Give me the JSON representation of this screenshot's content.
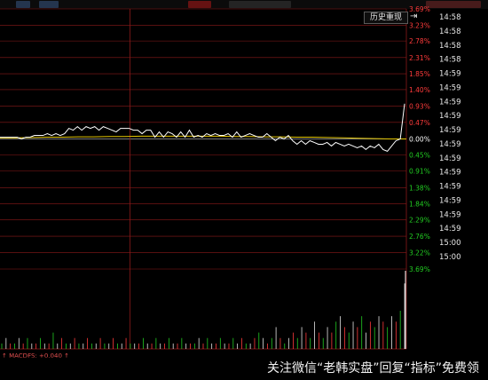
{
  "topbar": {},
  "history_button": {
    "label": "历史重现",
    "arrow_icon": "exit-arrow-icon"
  },
  "macd": {
    "label": "↑  MACDFS: +0.040 ↑"
  },
  "watermark": "关注微信“老韩实盘”回复“指标”免费领",
  "colors": {
    "grid": "#8b1a1a",
    "price": "#ffffff",
    "avg": "#e6c800",
    "pos": "#ff3b3b",
    "neg": "#22cc22",
    "zero": "#ffffff"
  },
  "chart_data": {
    "type": "line",
    "pct_ticks": [
      "3.69%",
      "3.23%",
      "2.78%",
      "2.31%",
      "1.85%",
      "1.40%",
      "0.93%",
      "0.47%",
      "0.00%",
      "0.45%",
      "0.91%",
      "1.38%",
      "1.84%",
      "2.29%",
      "2.76%",
      "3.22%",
      "3.69%"
    ],
    "pct_values": [
      3.69,
      3.23,
      2.78,
      2.31,
      1.85,
      1.4,
      0.93,
      0.47,
      0.0,
      -0.45,
      -0.91,
      -1.38,
      -1.84,
      -2.29,
      -2.76,
      -3.22,
      -3.69
    ],
    "time_ticks": [
      "14:58",
      "14:58",
      "14:58",
      "14:58",
      "14:59",
      "14:59",
      "14:59",
      "14:59",
      "14:59",
      "14:59",
      "14:59",
      "14:59",
      "14:59",
      "14:59",
      "14:59",
      "14:59",
      "15:00",
      "15:00"
    ],
    "ylim": [
      -3.69,
      3.69
    ],
    "price_series": [
      0.05,
      0.05,
      0.05,
      0.05,
      0.05,
      0.0,
      0.05,
      0.05,
      0.1,
      0.1,
      0.1,
      0.15,
      0.1,
      0.15,
      0.1,
      0.15,
      0.3,
      0.25,
      0.35,
      0.25,
      0.35,
      0.3,
      0.35,
      0.25,
      0.35,
      0.3,
      0.25,
      0.2,
      0.3,
      0.3,
      0.3,
      0.25,
      0.25,
      0.15,
      0.25,
      0.25,
      0.05,
      0.2,
      0.05,
      0.2,
      0.15,
      0.05,
      0.2,
      0.05,
      0.25,
      0.05,
      0.1,
      0.05,
      0.15,
      0.1,
      0.15,
      0.1,
      0.1,
      0.15,
      0.05,
      0.2,
      0.05,
      0.1,
      0.15,
      0.1,
      0.05,
      0.05,
      0.15,
      0.05,
      -0.05,
      0.05,
      0.0,
      0.1,
      -0.05,
      -0.15,
      -0.05,
      -0.15,
      -0.05,
      -0.1,
      -0.15,
      -0.15,
      -0.1,
      -0.2,
      -0.1,
      -0.15,
      -0.2,
      -0.15,
      -0.2,
      -0.25,
      -0.2,
      -0.3,
      -0.2,
      -0.25,
      -0.15,
      -0.3,
      -0.35,
      -0.2,
      -0.05,
      0.0,
      1.0
    ],
    "avg_series": [
      0.03,
      0.03,
      0.04,
      0.05,
      0.05,
      0.06,
      0.06,
      0.07,
      0.07,
      0.08,
      0.08,
      0.08,
      0.08,
      0.08,
      0.08,
      0.07,
      0.07,
      0.06,
      0.06,
      0.05,
      0.05,
      0.04,
      0.03,
      0.02,
      0.01,
      0.0,
      0.0
    ],
    "volume": [
      1,
      2,
      1,
      1,
      2,
      1,
      2,
      1,
      1,
      2,
      1,
      1,
      3,
      1,
      2,
      1,
      1,
      2,
      1,
      1,
      2,
      1,
      1,
      2,
      1,
      1,
      2,
      1,
      1,
      2,
      1,
      1,
      1,
      2,
      1,
      1,
      2,
      1,
      1,
      2,
      1,
      1,
      2,
      1,
      1,
      1,
      2,
      1,
      2,
      1,
      1,
      2,
      1,
      1,
      2,
      1,
      2,
      1,
      1,
      2,
      3,
      2,
      1,
      2,
      4,
      2,
      1,
      2,
      3,
      2,
      4,
      3,
      2,
      5,
      3,
      2,
      4,
      3,
      5,
      6,
      4,
      3,
      5,
      4,
      6,
      3,
      5,
      4,
      6,
      5,
      4,
      6,
      5,
      7,
      12
    ],
    "vline_at": 0.32
  }
}
